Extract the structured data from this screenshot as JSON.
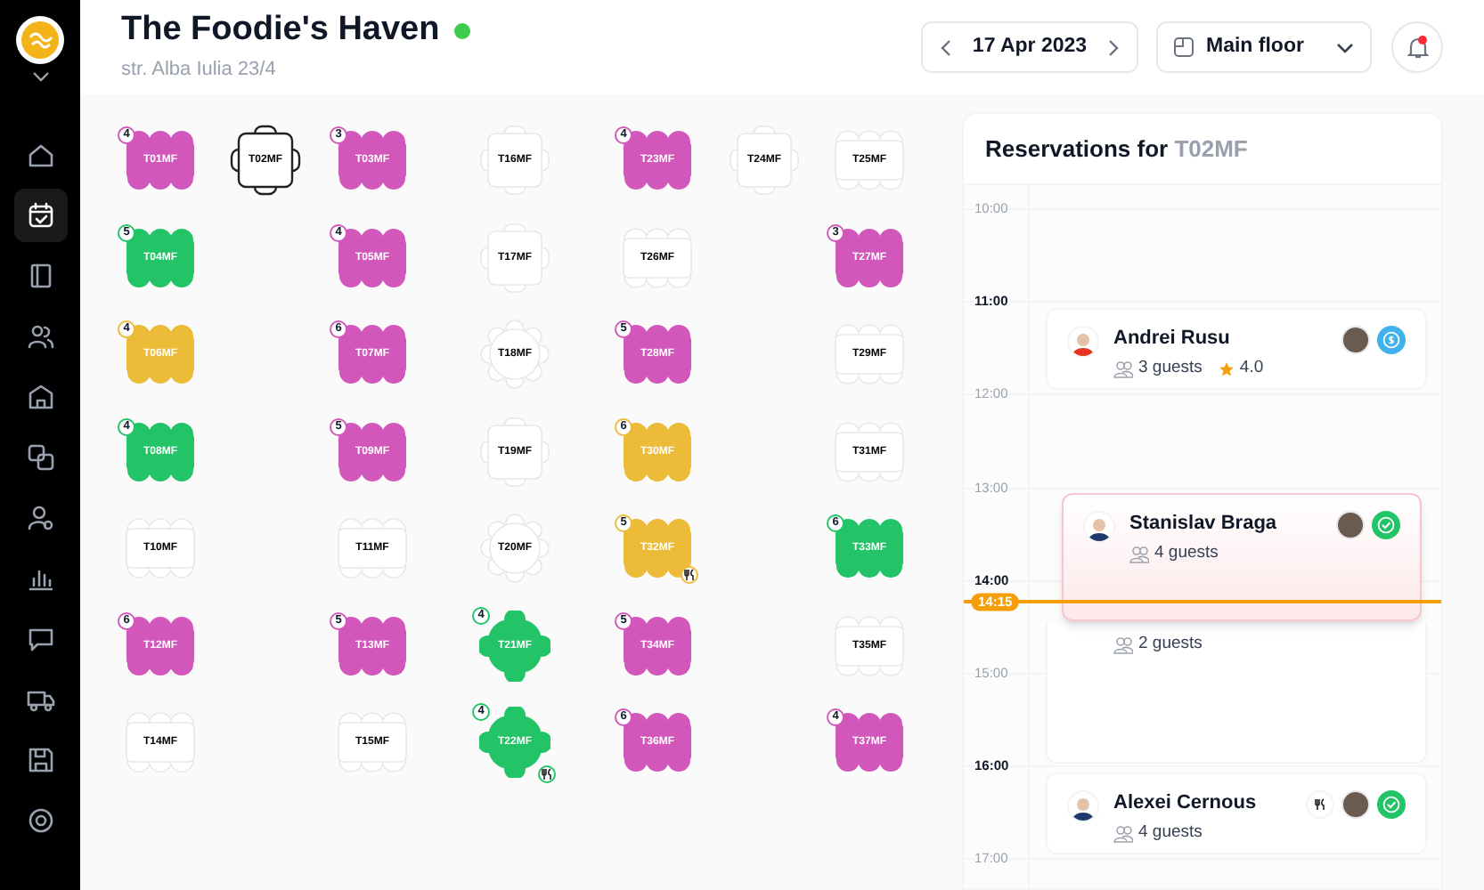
{
  "sidebar": {
    "items": [
      {
        "selected": false
      },
      {
        "selected": true
      },
      {
        "selected": false
      },
      {
        "selected": false
      },
      {
        "selected": false
      },
      {
        "selected": false
      },
      {
        "selected": false
      },
      {
        "selected": false
      },
      {
        "selected": false
      },
      {
        "selected": false
      },
      {
        "selected": false
      },
      {
        "selected": false
      }
    ]
  },
  "header": {
    "title": "The Foodie's Haven",
    "online": true,
    "address": "str. Alba Iulia 23/4",
    "date": "17 Apr 2023",
    "floor": "Main floor",
    "has_notifications": true
  },
  "floor": {
    "rows": [
      [
        {
          "label": "T01MF",
          "kind": "rect",
          "color": "#d257bb",
          "guests": "4",
          "served": false,
          "selected": false
        },
        {
          "label": "T02MF",
          "kind": "square",
          "color": "#ffffff",
          "served": false,
          "selected": true
        },
        {
          "label": "T03MF",
          "kind": "rect",
          "color": "#d257bb",
          "guests": "3",
          "served": false,
          "selected": false
        },
        {
          "label": "T16MF",
          "kind": "square",
          "color": "#ffffff",
          "served": false,
          "selected": false
        },
        {
          "label": "T23MF",
          "kind": "rect",
          "color": "#d257bb",
          "guests": "4",
          "served": false,
          "selected": false
        },
        {
          "label": "T24MF",
          "kind": "square",
          "color": "#ffffff",
          "served": false,
          "selected": false
        },
        {
          "label": "T25MF",
          "kind": "rect",
          "color": "#ffffff",
          "served": false,
          "selected": false
        }
      ],
      [
        {
          "label": "T04MF",
          "kind": "rect",
          "color": "#22c467",
          "guests": "5",
          "served": false,
          "selected": false
        },
        "",
        {
          "label": "T05MF",
          "kind": "rect",
          "color": "#d257bb",
          "guests": "4",
          "served": false,
          "selected": false
        },
        {
          "label": "T17MF",
          "kind": "square",
          "color": "#ffffff",
          "served": false,
          "selected": false
        },
        {
          "label": "T26MF",
          "kind": "rect",
          "color": "#ffffff",
          "served": false,
          "selected": false
        },
        "",
        {
          "label": "T27MF",
          "kind": "rect",
          "color": "#d257bb",
          "guests": "3",
          "served": false,
          "selected": false
        }
      ],
      [
        {
          "label": "T06MF",
          "kind": "rect",
          "color": "#ecbb38",
          "guests": "4",
          "served": false,
          "selected": false
        },
        "",
        {
          "label": "T07MF",
          "kind": "rect",
          "color": "#d257bb",
          "guests": "6",
          "served": false,
          "selected": false
        },
        {
          "label": "T18MF",
          "kind": "round",
          "color": "#ffffff",
          "served": false,
          "selected": false
        },
        {
          "label": "T28MF",
          "kind": "rect",
          "color": "#d257bb",
          "guests": "5",
          "served": false,
          "selected": false
        },
        "",
        {
          "label": "T29MF",
          "kind": "rect",
          "color": "#ffffff",
          "served": false,
          "selected": false
        }
      ],
      [
        {
          "label": "T08MF",
          "kind": "rect",
          "color": "#22c467",
          "guests": "4",
          "served": false,
          "selected": false
        },
        "",
        {
          "label": "T09MF",
          "kind": "rect",
          "color": "#d257bb",
          "guests": "5",
          "served": false,
          "selected": false
        },
        {
          "label": "T19MF",
          "kind": "square",
          "color": "#ffffff",
          "served": false,
          "selected": false
        },
        {
          "label": "T30MF",
          "kind": "rect",
          "color": "#ecbb38",
          "guests": "6",
          "served": false,
          "selected": false
        },
        "",
        {
          "label": "T31MF",
          "kind": "rect",
          "color": "#ffffff",
          "served": false,
          "selected": false
        }
      ],
      [
        {
          "label": "T10MF",
          "kind": "rect",
          "color": "#ffffff",
          "served": false,
          "selected": false
        },
        "",
        {
          "label": "T11MF",
          "kind": "rect",
          "color": "#ffffff",
          "served": false,
          "selected": false
        },
        {
          "label": "T20MF",
          "kind": "round",
          "color": "#ffffff",
          "served": false,
          "selected": false
        },
        {
          "label": "T32MF",
          "kind": "rect",
          "color": "#ecbb38",
          "guests": "5",
          "served": true,
          "selected": false
        },
        "",
        {
          "label": "T33MF",
          "kind": "rect",
          "color": "#22c467",
          "guests": "6",
          "served": false,
          "selected": false
        }
      ],
      [
        {
          "label": "T12MF",
          "kind": "rect",
          "color": "#d257bb",
          "guests": "6",
          "served": false,
          "selected": false
        },
        "",
        {
          "label": "T13MF",
          "kind": "rect",
          "color": "#d257bb",
          "guests": "5",
          "served": false,
          "selected": false
        },
        {
          "label": "T21MF",
          "kind": "cross",
          "color": "#22c467",
          "guests": "4",
          "served": false,
          "selected": false
        },
        {
          "label": "T34MF",
          "kind": "rect",
          "color": "#d257bb",
          "guests": "5",
          "served": false,
          "selected": false
        },
        "",
        {
          "label": "T35MF",
          "kind": "rect",
          "color": "#ffffff",
          "served": false,
          "selected": false
        }
      ],
      [
        {
          "label": "T14MF",
          "kind": "rect",
          "color": "#ffffff",
          "served": false,
          "selected": false
        },
        "",
        {
          "label": "T15MF",
          "kind": "rect",
          "color": "#ffffff",
          "served": false,
          "selected": false
        },
        {
          "label": "T22MF",
          "kind": "cross",
          "color": "#22c467",
          "guests": "4",
          "served": true,
          "selected": false
        },
        {
          "label": "T36MF",
          "kind": "rect",
          "color": "#d257bb",
          "guests": "6",
          "served": false,
          "selected": false
        },
        "",
        {
          "label": "T37MF",
          "kind": "rect",
          "color": "#d257bb",
          "guests": "4",
          "served": false,
          "selected": false
        }
      ]
    ]
  },
  "reservations_panel": {
    "title": "Reservations for ",
    "table": "T02MF",
    "hours": [
      {
        "time": "10:00",
        "highlighted": false
      },
      {
        "time": "11:00",
        "highlighted": true
      },
      {
        "time": "12:00",
        "highlighted": false
      },
      {
        "time": "13:00",
        "highlighted": false
      },
      {
        "time": "14:00",
        "highlighted": true
      },
      {
        "time": "15:00",
        "highlighted": false
      },
      {
        "time": "16:00",
        "highlighted": true
      },
      {
        "time": "17:00",
        "highlighted": false
      }
    ],
    "now": "14:15",
    "reservations": [
      {
        "name": "Andrei Rusu",
        "guests": "3 guests",
        "rating": "4.0",
        "kind": "paid",
        "served": false,
        "dragging": false
      },
      {
        "name": "Stanislav Braga",
        "guests": "4 guests",
        "kind": "confirmed",
        "served": false,
        "dragging": true
      },
      {
        "guests": "2 guests",
        "served": false,
        "dragging": false
      },
      {
        "name": "Alexei Cernous",
        "guests": "4 guests",
        "kind": "confirmed",
        "served": true,
        "dragging": false
      }
    ]
  }
}
